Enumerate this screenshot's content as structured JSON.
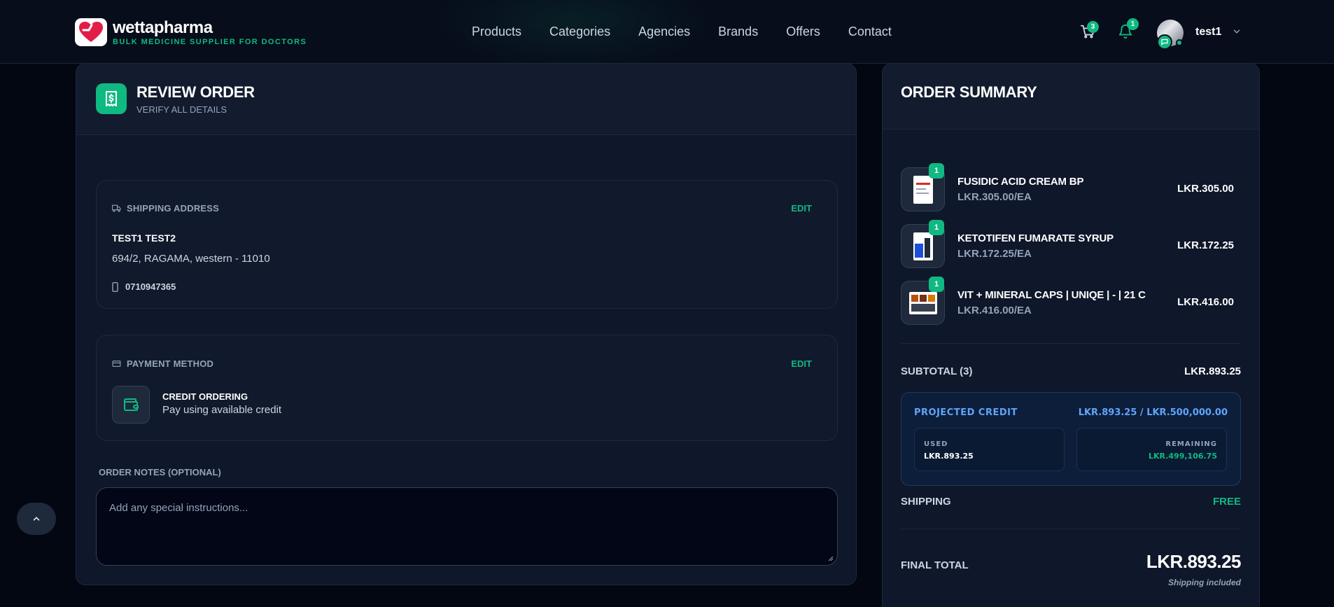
{
  "brand": {
    "name": "wettapharma",
    "tagline": "BULK MEDICINE SUPPLIER FOR DOCTORS"
  },
  "nav": {
    "links": [
      "Products",
      "Categories",
      "Agencies",
      "Brands",
      "Offers",
      "Contact"
    ],
    "cart_count": "3",
    "notification_count": "1",
    "user_name": "test1"
  },
  "review": {
    "title": "REVIEW ORDER",
    "subtitle": "VERIFY ALL DETAILS",
    "shipping": {
      "label": "SHIPPING ADDRESS",
      "edit": "EDIT",
      "name": "TEST1 TEST2",
      "address": "694/2, RAGAMA, western - 11010",
      "phone": "0710947365"
    },
    "payment": {
      "label": "PAYMENT METHOD",
      "edit": "EDIT",
      "method": "CREDIT ORDERING",
      "description": "Pay using available credit"
    },
    "notes": {
      "label": "ORDER NOTES (OPTIONAL)",
      "placeholder": "Add any special instructions...",
      "value": ""
    }
  },
  "summary": {
    "title": "ORDER SUMMARY",
    "items": [
      {
        "qty": "1",
        "name": "FUSIDIC ACID CREAM BP",
        "unit_price": "LKR.305.00/EA",
        "total": "LKR.305.00"
      },
      {
        "qty": "1",
        "name": "KETOTIFEN FUMARATE SYRUP",
        "unit_price": "LKR.172.25/EA",
        "total": "LKR.172.25"
      },
      {
        "qty": "1",
        "name": "VIT + MINERAL CAPS | UNIQE | - | 21 C",
        "unit_price": "LKR.416.00/EA",
        "total": "LKR.416.00"
      }
    ],
    "subtotal_label": "SUBTOTAL (3)",
    "subtotal_value": "LKR.893.25",
    "credit": {
      "title": "PROJECTED CREDIT",
      "amount": "LKR.893.25 / LKR.500,000.00",
      "used_label": "USED",
      "used_value": "LKR.893.25",
      "remaining_label": "REMAINING",
      "remaining_value": "LKR.499,106.75"
    },
    "shipping_label": "SHIPPING",
    "shipping_value": "FREE",
    "final_label": "FINAL TOTAL",
    "final_value": "LKR.893.25",
    "final_note": "Shipping included"
  },
  "colors": {
    "accent": "#10b981",
    "background": "#030712",
    "panel": "#0f172a",
    "credit_text": "#60a5fa"
  },
  "icons": {
    "cart": "cart-icon",
    "bell": "bell-icon",
    "receipt": "receipt-icon",
    "truck": "truck-icon",
    "card": "credit-card-icon",
    "phone": "phone-icon",
    "wallet": "wallet-icon",
    "chevron_up": "chevron-up-icon"
  }
}
